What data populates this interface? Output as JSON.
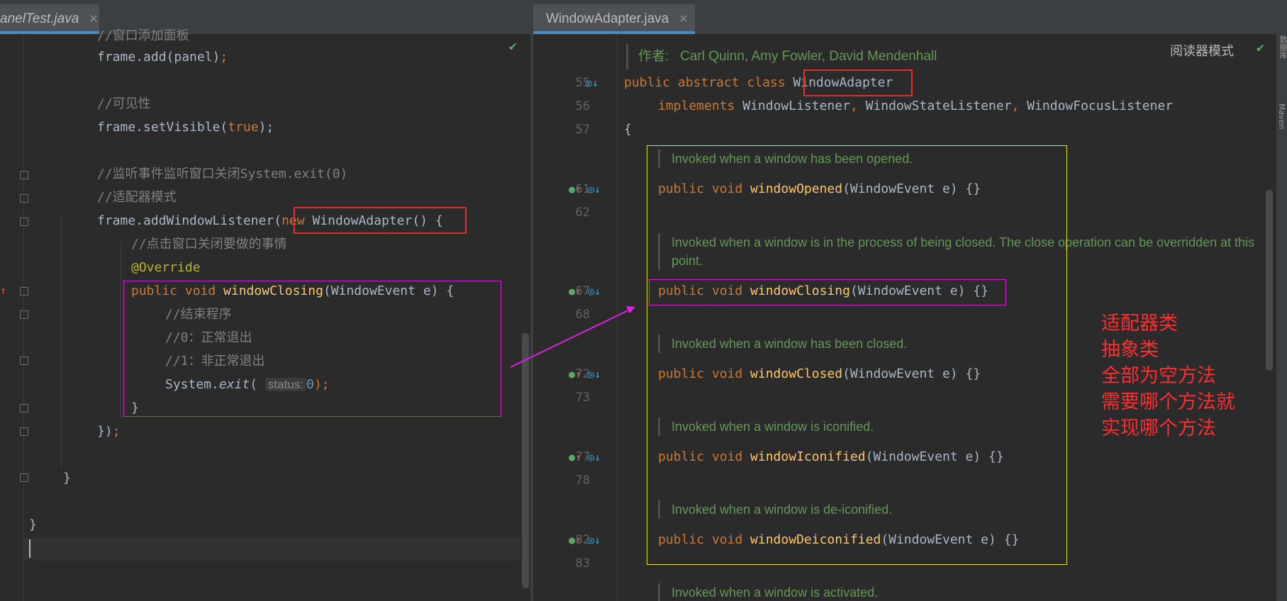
{
  "left_editor": {
    "tab": {
      "label": "anelTest.java",
      "close": "✕"
    },
    "check": "✔",
    "lines": {
      "l0": "//窗口添加面板",
      "l1a": "frame.add(panel)",
      "l1b": ";",
      "l3": "//可见性",
      "l4a": "frame.setVisible(",
      "l4b": "true",
      "l4c": ");",
      "l6": "//监听事件监听窗口关闭System.exit(0)",
      "l7": "//适配器模式",
      "l8a": "frame.addWindowListener(",
      "l8b": "new ",
      "l8c": "WindowAdapter() {",
      "l9": "//点击窗口关闭要做的事情",
      "l10": "@Override",
      "l11a": "public void ",
      "l11b": "windowClosing",
      "l11c": "(WindowEvent e) {",
      "l12": "//结束程序",
      "l13": "//0：正常退出",
      "l14": "//1：非正常退出",
      "l15a": "System.",
      "l15b": "exit",
      "l15c": "( ",
      "l15hint": "status:",
      "l15d": "0",
      "l15e": ");",
      "l16": "}",
      "l17a": "})",
      "l17b": ";",
      "l19": "}",
      "l21": "}"
    }
  },
  "right_editor": {
    "tab": {
      "label": "WindowAdapter.java",
      "close": "✕"
    },
    "reader_mode": "阅读器模式",
    "check": "✔",
    "side_labels": {
      "top": "数据库",
      "bottom": "Maven"
    },
    "author_label": "作者:",
    "author_names": "Carl Quinn, Amy Fowler, David Mendenhall",
    "line_numbers": [
      "55",
      "56",
      "57",
      "61",
      "62",
      "67",
      "68",
      "72",
      "73",
      "77",
      "78",
      "82",
      "83"
    ],
    "code": {
      "c55a": "public abstract class ",
      "c55b": "WindowAdapter",
      "c56a": "implements ",
      "c56b": "WindowListener",
      "c56c": ", ",
      "c56d": "WindowStateListener",
      "c56e": ", ",
      "c56f": "WindowFocusListener",
      "c57": "{",
      "kw_pv": "public void ",
      "opened": "windowOpened",
      "closing": "windowClosing",
      "closed": "windowClosed",
      "iconified": "windowIconified",
      "deiconified": "windowDeiconified",
      "params": "(WindowEvent e) {}"
    },
    "docs": {
      "opened": "Invoked when a window has been opened.",
      "closing": "Invoked when a window is in the process of being closed. The close operation can be overridden at this point.",
      "closed": "Invoked when a window has been closed.",
      "iconified": "Invoked when a window is iconified.",
      "deiconified": "Invoked when a window is de-iconified.",
      "activated": "Invoked when a window is activated."
    }
  },
  "annotation": {
    "lines": [
      "适配器类",
      "抽象类",
      "全部为空方法",
      "需要哪个方法就",
      "实现哪个方法"
    ],
    "color": "#ff2e2e"
  }
}
